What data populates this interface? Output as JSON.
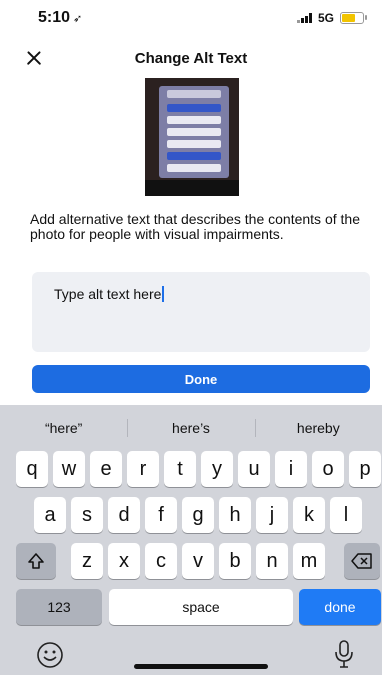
{
  "status": {
    "time": "5:10",
    "network": "5G"
  },
  "header": {
    "title": "Change Alt Text"
  },
  "description": "Add alternative text that describes the contents of the photo for people with visual impairments.",
  "field": {
    "value": "Type alt text here"
  },
  "done_button": "Done",
  "keyboard": {
    "suggestions": [
      "“here”",
      "here’s",
      "hereby"
    ],
    "row1": [
      "q",
      "w",
      "e",
      "r",
      "t",
      "y",
      "u",
      "i",
      "o",
      "p"
    ],
    "row2": [
      "a",
      "s",
      "d",
      "f",
      "g",
      "h",
      "j",
      "k",
      "l"
    ],
    "row3": [
      "z",
      "x",
      "c",
      "v",
      "b",
      "n",
      "m"
    ],
    "numbers_key": "123",
    "space_key": "space",
    "return_key": "done"
  },
  "colors": {
    "accent": "#1d6ce1",
    "keyboard_bg": "#d2d4da"
  },
  "icons": [
    "close-icon",
    "shift-icon",
    "backspace-icon",
    "emoji-icon",
    "microphone-icon",
    "location-arrow-icon"
  ]
}
